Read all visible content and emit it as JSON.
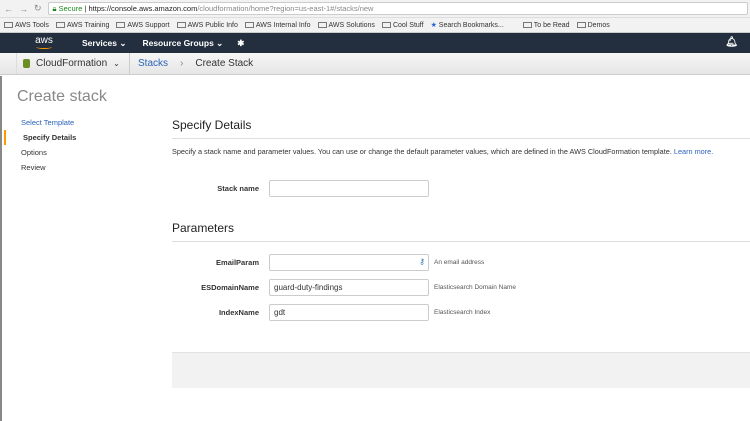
{
  "browser": {
    "secure": "Secure",
    "url_host": "https://console.aws.amazon.com",
    "url_path": "/cloudformation/home?region=us-east-1#/stacks/new",
    "bookmarks": [
      "AWS Tools",
      "AWS Training",
      "AWS Support",
      "AWS Public Info",
      "AWS Internal Info",
      "AWS Solutions",
      "Cool Stuff",
      "Search Bookmarks...",
      "To be Read",
      "Demos"
    ]
  },
  "topnav": {
    "logo": "aws",
    "services": "Services",
    "resource_groups": "Resource Groups"
  },
  "breadcrumb": {
    "service": "CloudFormation",
    "stacks": "Stacks",
    "current": "Create Stack"
  },
  "sidebar": {
    "title": "Create stack",
    "steps": [
      "Select Template",
      "Specify Details",
      "Options",
      "Review"
    ]
  },
  "main": {
    "title": "Specify Details",
    "description": "Specify a stack name and parameter values. You can use or change the default parameter values, which are defined in the AWS CloudFormation template.",
    "learn_more": "Learn more.",
    "stack_name_label": "Stack name",
    "stack_name_value": "",
    "parameters_title": "Parameters",
    "params": [
      {
        "label": "EmailParam",
        "value": "",
        "hint": "An email address"
      },
      {
        "label": "ESDomainName",
        "value": "guard-duty-findings",
        "hint": "Elasticsearch Domain Name"
      },
      {
        "label": "IndexName",
        "value": "gdt",
        "hint": "Elasticsearch Index"
      }
    ]
  }
}
